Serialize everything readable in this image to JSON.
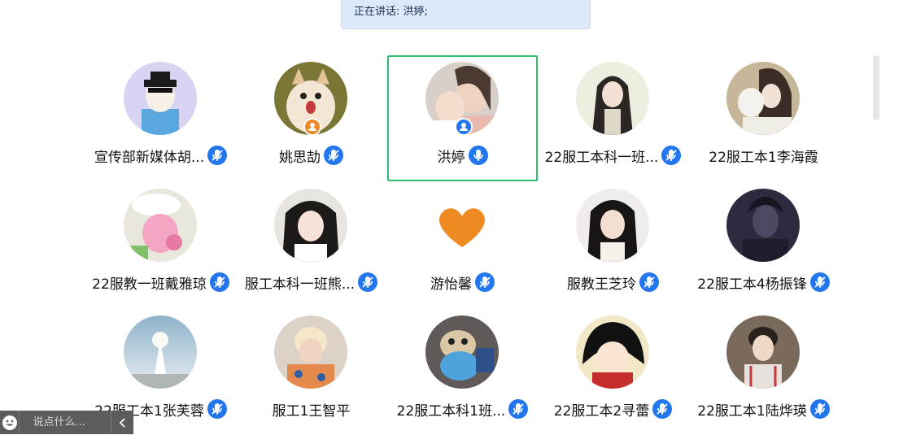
{
  "speaking": {
    "text": "正在讲话: 洪婷;"
  },
  "colors": {
    "active_border": "#2cc172",
    "mic_blue": "#2277ee",
    "host_orange": "#f08a24",
    "cohost_blue": "#2277ee"
  },
  "participants": [
    {
      "name": "宣传部新媒体胡...",
      "avatar": "avatar-cartoon-dog",
      "mic": "mic-muted-icon"
    },
    {
      "name": "姚思劼",
      "avatar": "avatar-kitten",
      "mic": "mic-muted-icon",
      "badge": "host-icon"
    },
    {
      "name": "洪婷",
      "avatar": "avatar-selfie",
      "mic": "mic-on-icon",
      "badge": "cohost-icon",
      "active": true
    },
    {
      "name": "22服工本科一班...",
      "avatar": "avatar-anime-girl",
      "mic": "mic-muted-icon"
    },
    {
      "name": "22服工本1李海霞",
      "avatar": "avatar-girl-cat",
      "mic": ""
    },
    {
      "name": "22服教一班戴雅琼",
      "avatar": "avatar-pink-character",
      "mic": "mic-muted-icon"
    },
    {
      "name": "服工本科一班熊...",
      "avatar": "avatar-girl-portrait",
      "mic": "mic-muted-icon"
    },
    {
      "name": "游怡馨",
      "avatar": "avatar-orange-heart",
      "mic": "mic-muted-icon"
    },
    {
      "name": "服教王芝玲",
      "avatar": "avatar-woman-retro",
      "mic": "mic-muted-icon"
    },
    {
      "name": "22服工本4杨振锋",
      "avatar": "avatar-dark-figure",
      "mic": "mic-muted-icon"
    },
    {
      "name": "22服工本1张芙蓉",
      "avatar": "avatar-lighthouse",
      "mic": "mic-muted-icon"
    },
    {
      "name": "服工1王智平",
      "avatar": "avatar-blond-boy",
      "mic": ""
    },
    {
      "name": "22服工本科1班...",
      "avatar": "avatar-cat-toy",
      "mic": "mic-muted-icon"
    },
    {
      "name": "22服工本2寻蕾",
      "avatar": "avatar-anime-woman",
      "mic": "mic-muted-icon"
    },
    {
      "name": "22服工本1陆烨瑛",
      "avatar": "avatar-young-man",
      "mic": "mic-muted-icon"
    }
  ],
  "chat": {
    "placeholder": "说点什么...",
    "emoji_icon": "smiley-icon",
    "collapse_icon": "chevron-left-icon"
  }
}
